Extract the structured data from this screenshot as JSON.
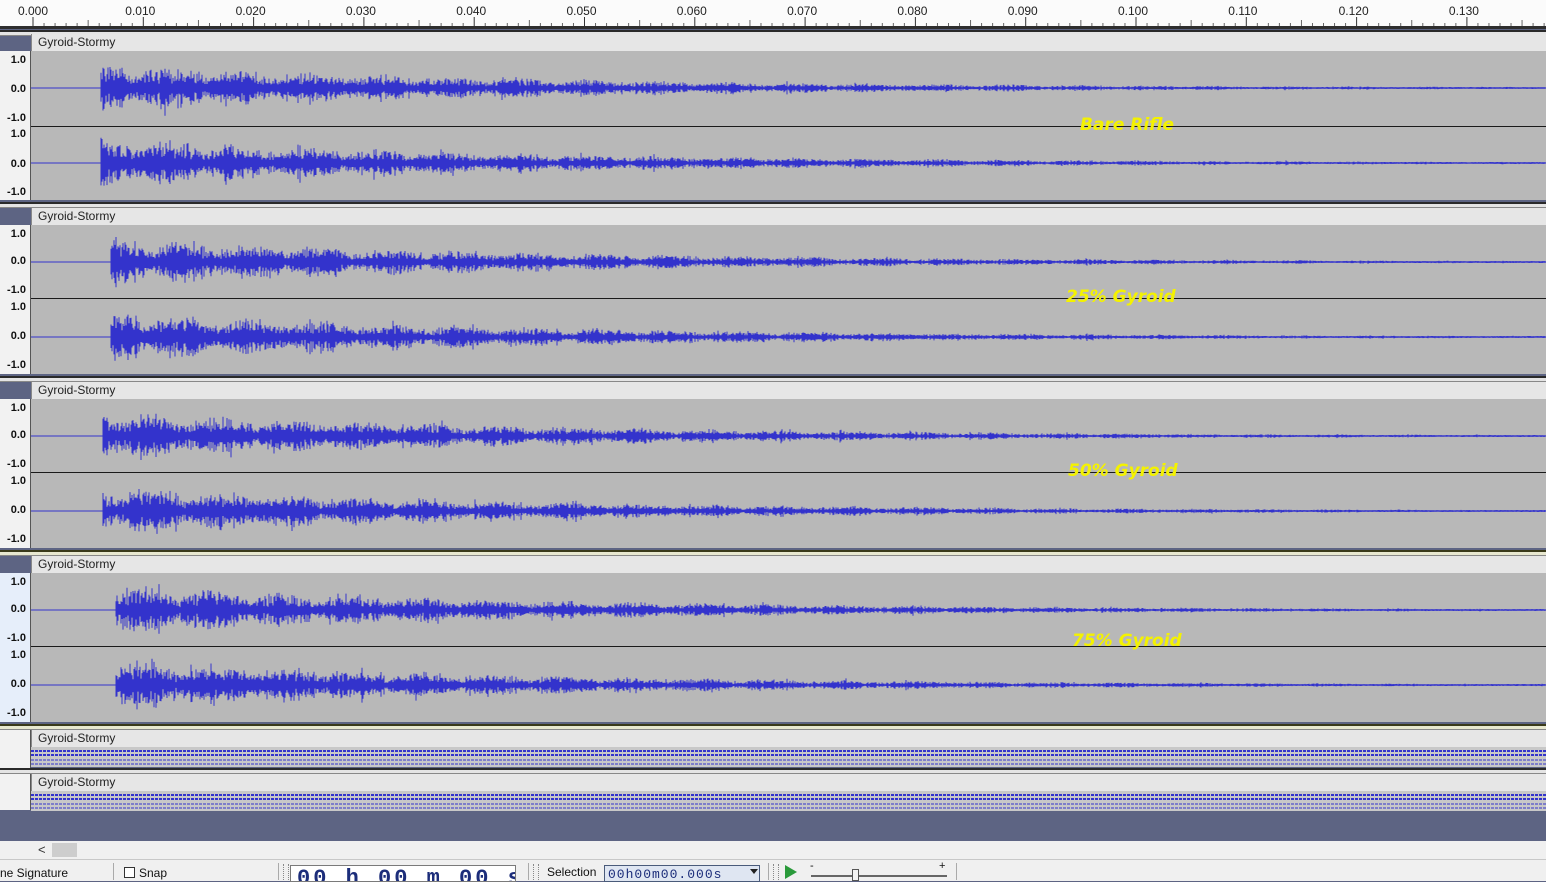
{
  "ruler": {
    "ticks": [
      "0.000",
      "0.010",
      "0.020",
      "0.030",
      "0.040",
      "0.050",
      "0.060",
      "0.070",
      "0.080",
      "0.090",
      "0.100",
      "0.110",
      "0.120",
      "0.130"
    ]
  },
  "colors": {
    "waveform": "#3333cc",
    "label": "#f4f200",
    "background": "#b8b8b8",
    "workspace": "#5d6483"
  },
  "tracks": [
    {
      "name": "Gyroid-Stormy",
      "label": "Bare Rifle",
      "scale": [
        "1.0",
        "0.0",
        "-1.0",
        "1.0",
        "0.0",
        "-1.0"
      ]
    },
    {
      "name": "Gyroid-Stormy",
      "label": "25% Gyroid",
      "scale": [
        "1.0",
        "0.0",
        "-1.0",
        "1.0",
        "0.0",
        "-1.0"
      ]
    },
    {
      "name": "Gyroid-Stormy",
      "label": "50% Gyroid",
      "scale": [
        "1.0",
        "0.0",
        "-1.0",
        "1.0",
        "0.0",
        "-1.0"
      ]
    },
    {
      "name": "Gyroid-Stormy",
      "label": "75% Gyroid",
      "scale": [
        "1.0",
        "0.0",
        "-1.0",
        "1.0",
        "0.0",
        "-1.0"
      ]
    }
  ],
  "collapsed_tracks": [
    {
      "name": "Gyroid-Stormy"
    },
    {
      "name": "Gyroid-Stormy"
    }
  ],
  "hscroll": {
    "left_arrow": "<"
  },
  "statusbar": {
    "time_signature_label": "ne Signature",
    "snap_label": "Snap",
    "big_time": "00 h 00 m 00 s",
    "selection_label": "Selection",
    "selection_value": "00h00m00.000s",
    "dropdown_icon": "chevron-down-icon",
    "slider_min": "-",
    "slider_max": "+"
  }
}
